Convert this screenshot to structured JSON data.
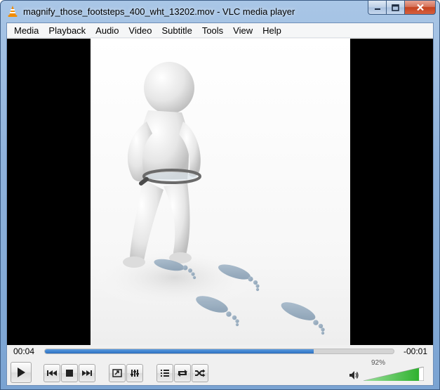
{
  "window": {
    "title": "magnify_those_footsteps_400_wht_13202.mov - VLC media player",
    "icons": {
      "app": "vlc-cone-icon",
      "minimize": "minimize-icon",
      "maximize": "maximize-icon",
      "close": "close-icon"
    }
  },
  "menu": {
    "items": [
      "Media",
      "Playback",
      "Audio",
      "Video",
      "Subtitle",
      "Tools",
      "View",
      "Help"
    ]
  },
  "player": {
    "elapsed": "00:04",
    "remaining": "-00:01",
    "progress_fraction": 0.77,
    "volume_percent": 0.92,
    "volume_label": "92%"
  },
  "controls": {
    "buttons": [
      {
        "name": "play-button",
        "icon": "play-icon"
      },
      {
        "name": "previous-button",
        "icon": "previous-icon"
      },
      {
        "name": "stop-button",
        "icon": "stop-icon"
      },
      {
        "name": "next-button",
        "icon": "next-icon"
      },
      {
        "name": "fullscreen-button",
        "icon": "fullscreen-icon"
      },
      {
        "name": "extended-settings-button",
        "icon": "equalizer-icon"
      },
      {
        "name": "playlist-button",
        "icon": "playlist-icon"
      },
      {
        "name": "loop-button",
        "icon": "loop-icon"
      },
      {
        "name": "random-button",
        "icon": "shuffle-icon"
      }
    ]
  },
  "colors": {
    "accent": "#2b6fc0",
    "volume": "#3fbf3f"
  }
}
